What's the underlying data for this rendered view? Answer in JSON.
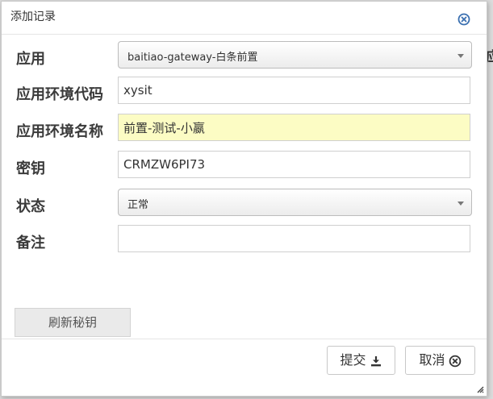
{
  "background": {
    "edge_text": "应"
  },
  "dialog": {
    "title": "添加记录",
    "close_icon": "circle-x-icon"
  },
  "form": {
    "app": {
      "label": "应用",
      "value": "baitiao-gateway-白条前置"
    },
    "env_code": {
      "label": "应用环境代码",
      "value": "xysit"
    },
    "env_name": {
      "label": "应用环境名称",
      "value": "前置-测试-小嬴"
    },
    "secret_key": {
      "label": "密钥",
      "value": "CRMZW6PI73"
    },
    "status": {
      "label": "状态",
      "value": "正常"
    },
    "remark": {
      "label": "备注",
      "value": ""
    }
  },
  "buttons": {
    "refresh_key": "刷新秘钥",
    "submit": "提交",
    "submit_icon": "download-icon",
    "cancel": "取消",
    "cancel_icon": "circle-x-icon"
  },
  "colors": {
    "highlight_input": "#fcfcc4",
    "accent_icon": "#3a6fb0"
  }
}
